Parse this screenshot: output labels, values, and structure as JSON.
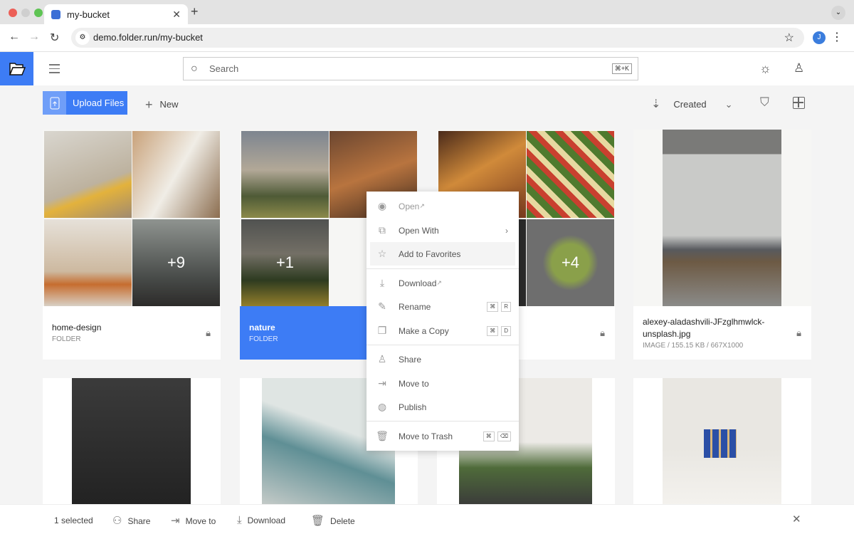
{
  "browser": {
    "tab_title": "my-bucket",
    "url": "demo.folder.run/my-bucket",
    "profile_initial": "J"
  },
  "header": {
    "search_placeholder": "Search",
    "search_shortcut": "⌘+K"
  },
  "toolbar": {
    "upload_label": "Upload Files",
    "new_label": "New",
    "sort_label": "Created"
  },
  "items": [
    {
      "name": "home-design",
      "type": "FOLDER",
      "overflow": "+9"
    },
    {
      "name": "nature",
      "type": "FOLDER",
      "overflow": "+1",
      "selected": true
    },
    {
      "name": "",
      "type": "",
      "overflow": "+4"
    },
    {
      "name": "alexey-aladashvili-JFzglhmwlck-unsplash.jpg",
      "type": "IMAGE / 155.15 KB / 667X1000"
    }
  ],
  "context_menu": {
    "open": "Open",
    "open_with": "Open With",
    "add_favorites": "Add to Favorites",
    "download": "Download",
    "rename": "Rename",
    "rename_key": "R",
    "copy": "Make a Copy",
    "copy_key": "D",
    "cmd": "⌘",
    "share": "Share",
    "move_to": "Move to",
    "publish": "Publish",
    "trash": "Move to Trash",
    "trash_key": "⌫"
  },
  "bottom_bar": {
    "selected": "1 selected",
    "share": "Share",
    "move_to": "Move to",
    "download": "Download",
    "delete": "Delete"
  }
}
